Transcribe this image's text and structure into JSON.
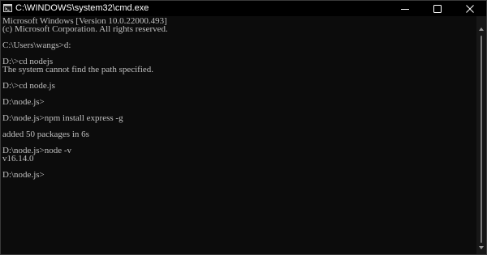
{
  "window": {
    "title": "C:\\WINDOWS\\system32\\cmd.exe",
    "icon": "cmd-icon"
  },
  "controls": {
    "minimize_icon": "minimize-icon",
    "maximize_icon": "maximize-icon",
    "close_icon": "close-icon"
  },
  "console": {
    "lines": [
      "Microsoft Windows [Version 10.0.22000.493]",
      "(c) Microsoft Corporation. All rights reserved.",
      "",
      "C:\\Users\\wangs>d:",
      "",
      "D:\\>cd nodejs",
      "The system cannot find the path specified.",
      "",
      "D:\\>cd node.js",
      "",
      "D:\\node.js>",
      "",
      "D:\\node.js>npm install express -g",
      "",
      "added 50 packages in 6s",
      "",
      "D:\\node.js>node -v",
      "v16.14.0",
      "",
      "D:\\node.js>"
    ]
  },
  "colors": {
    "background": "#0c0c0c",
    "text": "#c0c0c0",
    "titlebar": "#000000"
  }
}
